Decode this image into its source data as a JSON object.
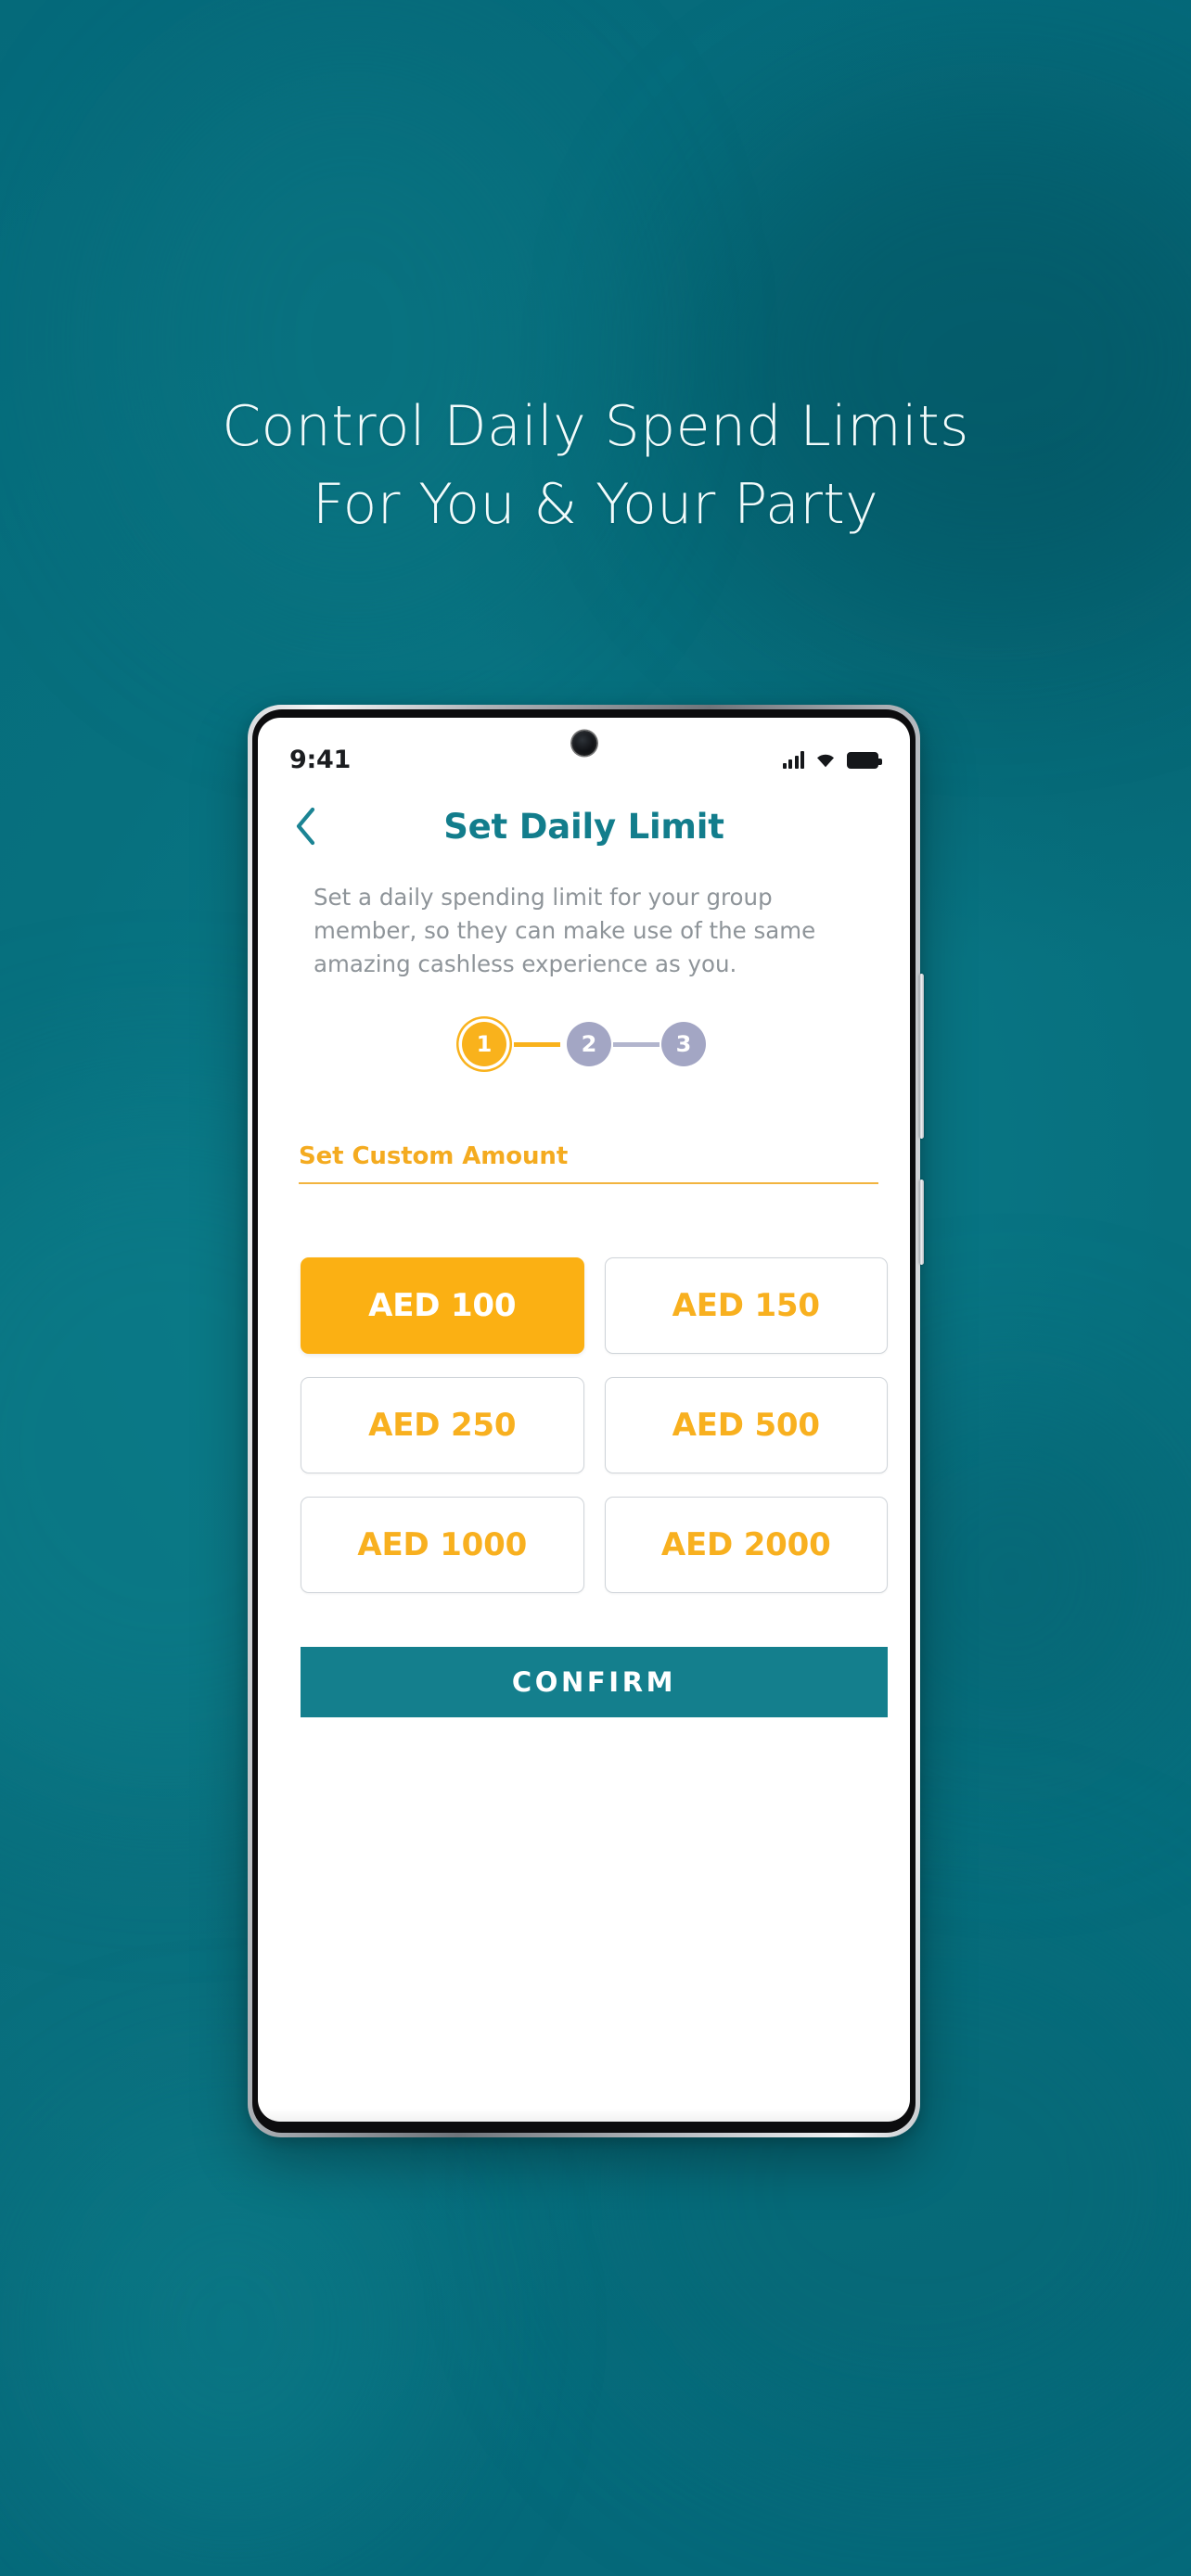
{
  "promo": {
    "headline_line_1": "Control Daily Spend Limits",
    "headline_line_2": "For You & Your Party",
    "background_color": "#07707e",
    "headline_color": "#f1fbfb"
  },
  "phone": {
    "status_bar": {
      "time": "9:41",
      "signal_icon": "signal-bars-icon",
      "wifi_icon": "wifi-icon",
      "battery_icon": "battery-full-icon"
    },
    "camera_icon": "front-camera-icon",
    "side_buttons": [
      "volume-rocker",
      "power-button"
    ]
  },
  "screen": {
    "header": {
      "back_icon": "chevron-left-icon",
      "title": "Set Daily Limit",
      "title_color": "#127d8c"
    },
    "description": "Set a daily spending limit for your group member, so they can make use of the same amazing cashless experience as you.",
    "stepper": {
      "current_step": 1,
      "total_steps": 3,
      "active_color": "#f9b21c",
      "inactive_color": "#a3a6c4",
      "steps": [
        {
          "label": "1",
          "state": "active"
        },
        {
          "label": "2",
          "state": "inactive"
        },
        {
          "label": "3",
          "state": "inactive"
        }
      ]
    },
    "custom_amount": {
      "label": "Set Custom Amount",
      "label_color": "#f4ab20",
      "rule_color": "#f2b43f"
    },
    "amount_options": [
      {
        "label": "AED 100",
        "selected": true
      },
      {
        "label": "AED 150",
        "selected": false
      },
      {
        "label": "AED 250",
        "selected": false
      },
      {
        "label": "AED 500",
        "selected": false
      },
      {
        "label": "AED 1000",
        "selected": false
      },
      {
        "label": "AED 2000",
        "selected": false
      }
    ],
    "confirm": {
      "label": "CONFIRM",
      "background_color": "#147f8d",
      "text_color": "#ffffff"
    }
  }
}
